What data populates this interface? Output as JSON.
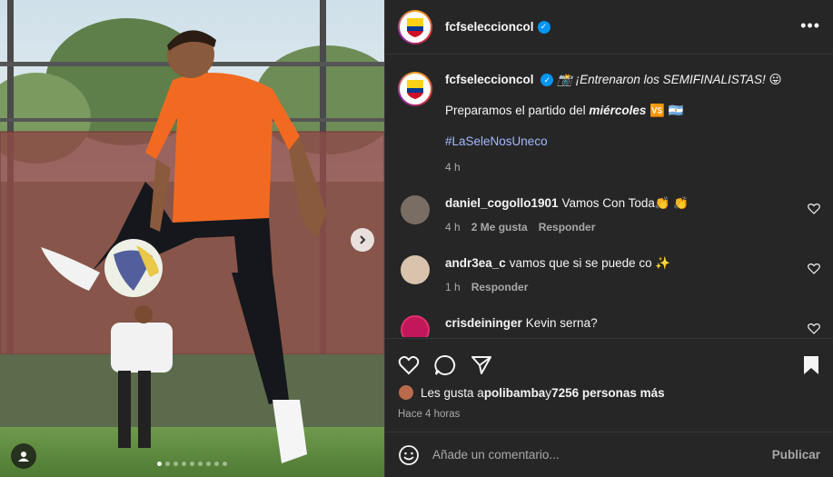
{
  "post": {
    "username": "fcfseleccioncol",
    "verified_icon": "verified-badge-icon",
    "more_icon": "more-horizontal-icon"
  },
  "caption": {
    "username": "fcfseleccioncol",
    "line1": "📸 ¡Entrenaron los SEMIFINALISTAS! 😛",
    "line2_prefix": "Preparamos el partido del ",
    "line2_emph": "miércoles",
    "line2_suffix": " 🆚 🇦🇷",
    "hashtag": "#LaSeleNosUneco",
    "time": "4 h"
  },
  "comments": [
    {
      "username": "daniel_cogollo1901",
      "text": "Vamos Con Toda👏 👏",
      "time": "4 h",
      "likes": "2 Me gusta",
      "reply": "Responder",
      "avatar_color": "#7a6e64"
    },
    {
      "username": "andr3ea_c",
      "text": "vamos que si se puede co ✨",
      "time": "1 h",
      "reply": "Responder",
      "avatar_color": "#d9c3ac"
    },
    {
      "username": "crisdeininger",
      "text": "Kevin serna?",
      "avatar_color": "#c2185b"
    }
  ],
  "actions": {
    "like_icon": "heart-icon",
    "comment_icon": "comment-icon",
    "share_icon": "send-icon",
    "save_icon": "bookmark-icon"
  },
  "likes": {
    "prefix": "Les gusta a ",
    "user": "polibamba",
    "middle": " y ",
    "count": "7256 personas más"
  },
  "posted_ago": "Hace 4 horas",
  "composer": {
    "placeholder": "Añade un comentario...",
    "publish_label": "Publicar",
    "emoji_icon": "emoji-icon"
  },
  "media": {
    "next_icon": "chevron-right-icon",
    "tag_icon": "user-tag-icon",
    "carousel_count": 9,
    "carousel_active": 1
  },
  "colors": {
    "panel_bg": "#262626",
    "accent_link": "#a3b9ff",
    "verified": "#0095f6",
    "jersey": "#f26a21"
  }
}
